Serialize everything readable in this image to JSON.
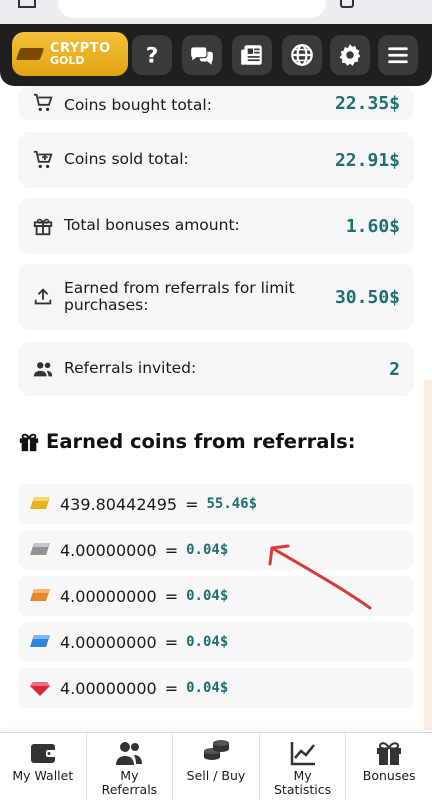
{
  "header": {
    "logo_line1": "CRYPTO",
    "logo_line2": "GOLD",
    "buttons": [
      "help-icon",
      "chat-icon",
      "news-icon",
      "language-globe-icon",
      "settings-gear-icon",
      "menu-hamburger-icon"
    ]
  },
  "stats": [
    {
      "label": "Coins bought total:",
      "value": "22.35$",
      "icon": "cart-icon"
    },
    {
      "label": "Coins sold total:",
      "value": "22.91$",
      "icon": "cart-sell-icon"
    },
    {
      "label": "Total bonuses amount:",
      "value": "1.60$",
      "icon": "gift-icon"
    },
    {
      "label": "Earned from referrals for limit purchases:",
      "value": "30.50$",
      "icon": "upload-icon"
    },
    {
      "label": "Referrals invited:",
      "value": "2",
      "icon": "users-icon"
    }
  ],
  "referral_section": {
    "title": "Earned coins from referrals:",
    "rows": [
      {
        "coin": "gold-bar-icon",
        "amount": "439.80442495",
        "eq": "=",
        "usd": "55.46$",
        "color": "#e8b21f"
      },
      {
        "coin": "silver-bar-icon",
        "amount": "4.00000000",
        "eq": "=",
        "usd": "0.04$",
        "color": "#8f9296"
      },
      {
        "coin": "bronze-bar-icon",
        "amount": "4.00000000",
        "eq": "=",
        "usd": "0.04$",
        "color": "#e6872b"
      },
      {
        "coin": "blue-bar-icon",
        "amount": "4.00000000",
        "eq": "=",
        "usd": "0.04$",
        "color": "#2f86d6"
      },
      {
        "coin": "ruby-gem-icon",
        "amount": "4.00000000",
        "eq": "=",
        "usd": "0.04$",
        "color": "#d7263d"
      }
    ]
  },
  "bottom_nav": [
    {
      "label": "My Wallet",
      "icon": "wallet-icon"
    },
    {
      "label": "My\nReferrals",
      "icon": "referrals-users-icon"
    },
    {
      "label": "Sell / Buy",
      "icon": "coins-stack-icon"
    },
    {
      "label": "My\nStatistics",
      "icon": "chart-line-icon"
    },
    {
      "label": "Bonuses",
      "icon": "gift-box-icon"
    }
  ],
  "colors": {
    "accent_value": "#1f6f73",
    "logo_gold": "#f4c13a",
    "header_bg": "#1f1f1f",
    "annotation_arrow": "#d83a3a"
  }
}
